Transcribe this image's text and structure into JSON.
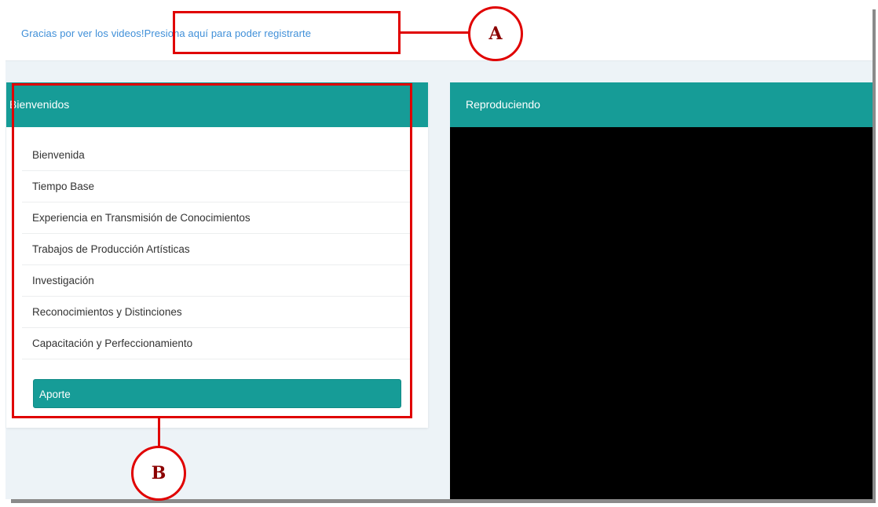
{
  "notice": {
    "text": "Gracias por ver los videos!",
    "link": "Presiona aquí para poder registrarte"
  },
  "sidebar": {
    "title": "Bienvenidos",
    "items": [
      {
        "label": "Bienvenida"
      },
      {
        "label": "Tiempo Base"
      },
      {
        "label": "Experiencia en Transmisión de Conocimientos"
      },
      {
        "label": "Trabajos de Producción Artísticas"
      },
      {
        "label": "Investigación"
      },
      {
        "label": "Reconocimientos y Distinciones"
      },
      {
        "label": "Capacitación y Perfeccionamiento"
      }
    ],
    "button": "Aporte"
  },
  "player": {
    "title": "Reproduciendo"
  },
  "annotations": {
    "a": "A",
    "b": "B"
  },
  "colors": {
    "accent": "#169c97",
    "link": "#3f8fd8",
    "annotation": "#e00000",
    "video_bg": "#000000"
  }
}
